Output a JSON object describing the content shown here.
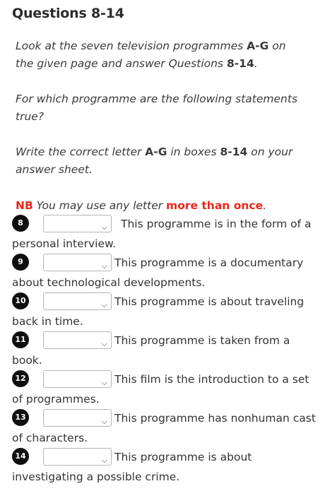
{
  "heading": "Questions 8-14",
  "intro": {
    "p1_a": "Look at the seven television programmes ",
    "p1_b": "A-G",
    "p1_c": " on the given page and answer Questions ",
    "p1_d": "8-14",
    "p1_e": ".",
    "p2": "For which programme are the following statements true?",
    "p3_a": "Write the correct letter ",
    "p3_b": "A-G",
    "p3_c": " in boxes ",
    "p3_d": "8-14",
    "p3_e": " on your answer sheet."
  },
  "nb": {
    "label": "NB",
    "text_a": " You may use any letter ",
    "emph": "more than once",
    "text_b": "."
  },
  "questions": [
    {
      "number": "8",
      "selected": "",
      "text": "This programme is in the form of a personal interview."
    },
    {
      "number": "9",
      "selected": "",
      "text": "This programme is a documentary about technological developments."
    },
    {
      "number": "10",
      "selected": "",
      "text": "This programme is about traveling back in time."
    },
    {
      "number": "11",
      "selected": "",
      "text": "This programme is taken from a book."
    },
    {
      "number": "12",
      "selected": "",
      "text": "This film is the introduction to a set of programmes."
    },
    {
      "number": "13",
      "selected": "",
      "text": "This programme has nonhuman cast of characters."
    },
    {
      "number": "14",
      "selected": "",
      "text": "This programme is about investigating a possible crime."
    }
  ],
  "icons": {
    "dropdown": "chevron-down-icon"
  }
}
